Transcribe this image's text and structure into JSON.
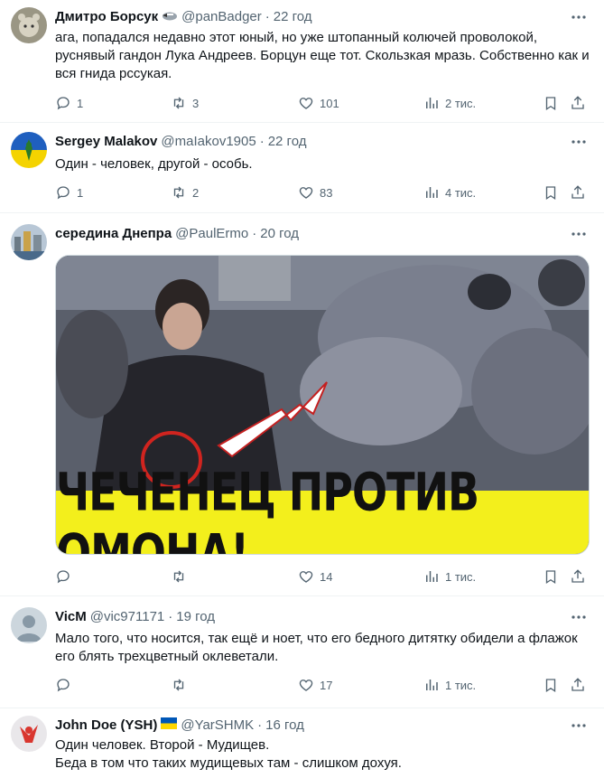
{
  "tweets": [
    {
      "name": "Дмитро Борсук",
      "handle": "@panBadger",
      "time": "22 год",
      "text": "ага, попадался недавно этот юный, но уже штопанный колючей проволокой,\nруснявый гандон Лука Андреев. Борцун еще тот. Скользкая мразь. Собственно как и\nвся гнида рссукая.",
      "replies": "1",
      "retweets": "3",
      "likes": "101",
      "views": "2 тис."
    },
    {
      "name": "Sergey Malakov",
      "handle": "@maIakov1905",
      "time": "22 год",
      "text": "Один - человек, другой - особь.",
      "replies": "1",
      "retweets": "2",
      "likes": "83",
      "views": "4 тис."
    },
    {
      "name": "середина Днепра",
      "handle": "@PaulErmo",
      "time": "20 год",
      "media_caption": "ЧЕЧЕНЕЦ ПРОТИВ ОМОНА!",
      "replies": "",
      "retweets": "",
      "likes": "14",
      "views": "1 тис."
    },
    {
      "name": "VicM",
      "handle": "@vic971171",
      "time": "19 год",
      "text": "Мало того, что носится, так ещё и ноет, что его бедного дитятку обидели а флажок\nего блять трехцветный оклеветали.",
      "replies": "",
      "retweets": "",
      "likes": "17",
      "views": "1 тис."
    },
    {
      "name": "John Doe (YSH)",
      "handle": "@YarSHMK",
      "time": "16 год",
      "text": "Один человек. Второй - Мудищев.\nБеда в том что таких мудищевых там - слишком дохуя."
    }
  ],
  "colors": {
    "text": "#0f1419",
    "muted": "#536471",
    "divider": "#eff3f4",
    "banner": "#f3ef1c",
    "verified_gray": "#829aab"
  }
}
